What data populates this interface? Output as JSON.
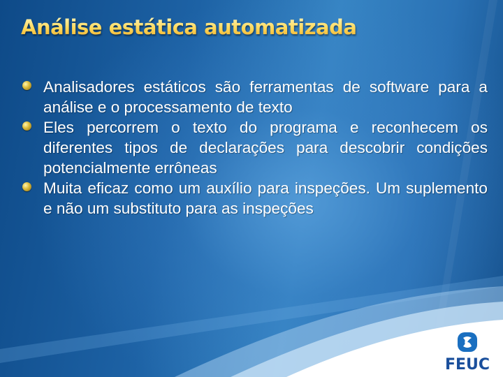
{
  "slide": {
    "title": "Análise estática automatizada",
    "bullets": [
      {
        "icon": "gold-sphere-bullet-icon",
        "text": "Analisadores estáticos são ferramentas de software para a análise e o processamento de texto"
      },
      {
        "icon": "gold-sphere-bullet-icon",
        "text": "Eles percorrem o texto do programa e reconhecem os diferentes tipos de declarações para descobrir condições potencialmente errôneas"
      },
      {
        "icon": "gold-sphere-bullet-icon",
        "text": "Muita eficaz como um auxílio para inspeções. Um suplemento e não um substituto para as inspeções"
      }
    ],
    "logo": {
      "name": "FEUC",
      "icon": "feuc-logo-icon"
    },
    "colors": {
      "background": "#1d62a5",
      "title": "#ffd95a",
      "text": "#ffffff",
      "logo": "#1a4f9c"
    }
  }
}
